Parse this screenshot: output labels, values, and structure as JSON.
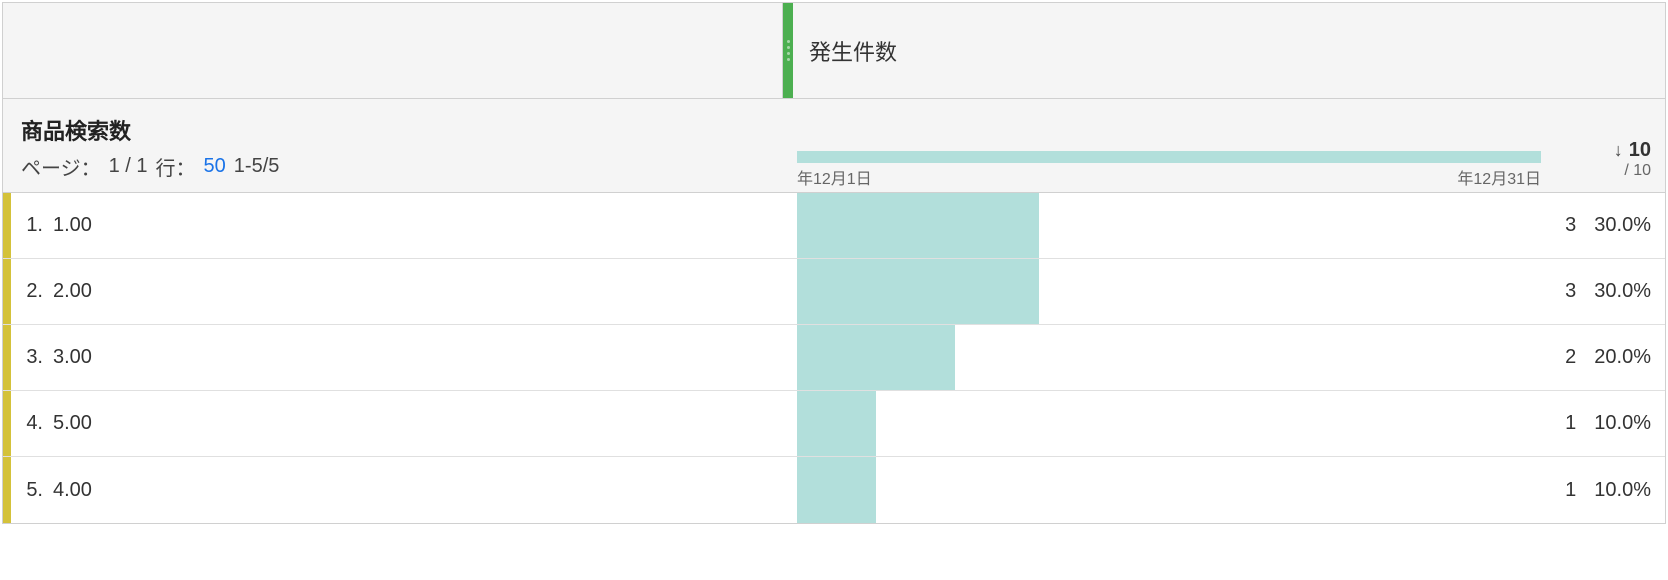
{
  "header": {
    "metric_column_label": "発生件数"
  },
  "subheader": {
    "dimension_title": "商品検索数",
    "pager_page_label": "ページ：",
    "pager_page_value": "1 / 1",
    "pager_rows_label": "行：",
    "pager_rows_value": "50",
    "pager_range": "1-5/5",
    "timeline_start": "年12月1日",
    "timeline_end": "年12月31日",
    "total_count": "10",
    "total_denom": "/ 10"
  },
  "rows": [
    {
      "idx": "1.",
      "value": "1.00",
      "count": "3",
      "pct": "30.0%"
    },
    {
      "idx": "2.",
      "value": "2.00",
      "count": "3",
      "pct": "30.0%"
    },
    {
      "idx": "3.",
      "value": "3.00",
      "count": "2",
      "pct": "20.0%"
    },
    {
      "idx": "4.",
      "value": "5.00",
      "count": "1",
      "pct": "10.0%"
    },
    {
      "idx": "5.",
      "value": "4.00",
      "count": "1",
      "pct": "10.0%"
    }
  ],
  "chart_data": {
    "type": "bar",
    "title": "発生件数",
    "dimension": "商品検索数",
    "categories": [
      "1.00",
      "2.00",
      "3.00",
      "5.00",
      "4.00"
    ],
    "values": [
      3,
      3,
      2,
      1,
      1
    ],
    "percentages": [
      30.0,
      30.0,
      20.0,
      10.0,
      10.0
    ],
    "total": 10,
    "date_range": [
      "年12月1日",
      "年12月31日"
    ]
  }
}
